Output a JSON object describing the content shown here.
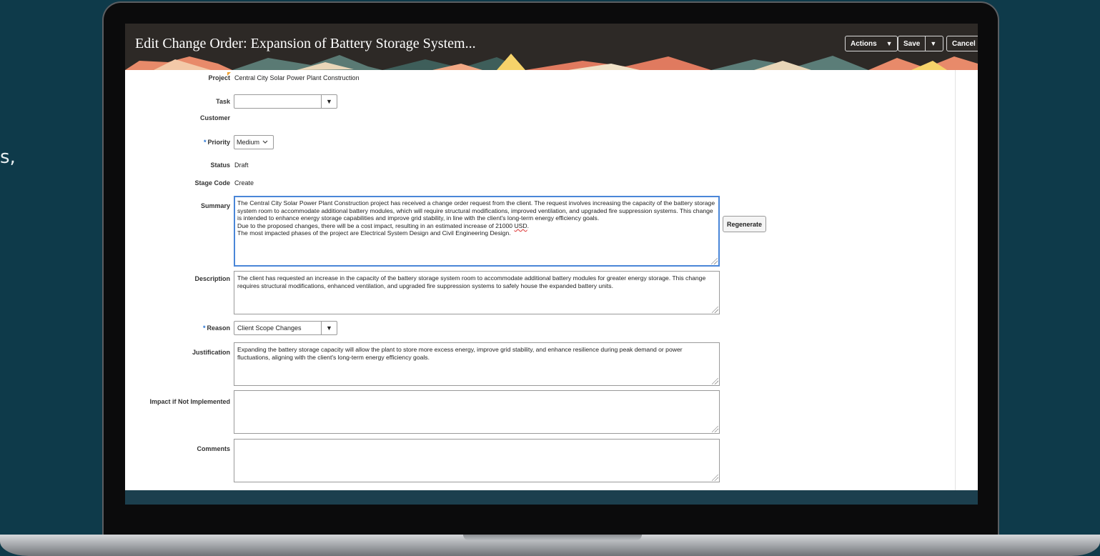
{
  "side_text": "s,",
  "header": {
    "title": "Edit Change Order: Expansion of Battery Storage System...",
    "actions_label": "Actions",
    "save_label": "Save",
    "cancel_label": "Cancel",
    "caret": "▼"
  },
  "form": {
    "project": {
      "label": "Project",
      "value": "Central City Solar Power Plant Construction"
    },
    "task": {
      "label": "Task",
      "value": ""
    },
    "customer": {
      "label": "Customer",
      "value": ""
    },
    "priority": {
      "label": "Priority",
      "value": "Medium"
    },
    "status": {
      "label": "Status",
      "value": "Draft"
    },
    "stage_code": {
      "label": "Stage Code",
      "value": "Create"
    },
    "summary": {
      "label": "Summary",
      "p1": "The Central City Solar Power Plant Construction project has received a change order request from the client. The request involves increasing the capacity of the battery storage system room to accommodate additional battery modules, which will require structural modifications, improved ventilation, and upgraded fire suppression systems. This change is intended to enhance energy storage capabilities and improve grid stability, in line with the client's long-term energy efficiency goals.",
      "p2_before": "Due to the proposed changes, there will be a cost impact, resulting in an estimated increase of 21000 ",
      "p2_usd": "USD",
      "p2_after": ".",
      "p3": "The most impacted phases of the project are Electrical System Design and Civil Engineering Design."
    },
    "regenerate_label": "Regenerate",
    "description": {
      "label": "Description",
      "value": "The client has requested an increase in the capacity of the battery storage system room to accommodate additional battery modules for greater energy storage. This change requires structural modifications, enhanced ventilation, and upgraded fire suppression systems to safely house the expanded battery units."
    },
    "reason": {
      "label": "Reason",
      "value": "Client Scope Changes"
    },
    "justification": {
      "label": "Justification",
      "value": "Expanding the battery storage capacity will allow the plant to store more excess energy, improve grid stability, and enhance resilience during peak demand or power fluctuations, aligning with the client's long-term energy efficiency goals."
    },
    "impact": {
      "label": "Impact if Not Implemented",
      "value": ""
    },
    "comments": {
      "label": "Comments",
      "value": ""
    },
    "required_mark": "*"
  },
  "colors": {
    "background": "#0e3a4a",
    "header": "#2d2926",
    "focus": "#4a86d8",
    "required": "#1f6fd1"
  }
}
